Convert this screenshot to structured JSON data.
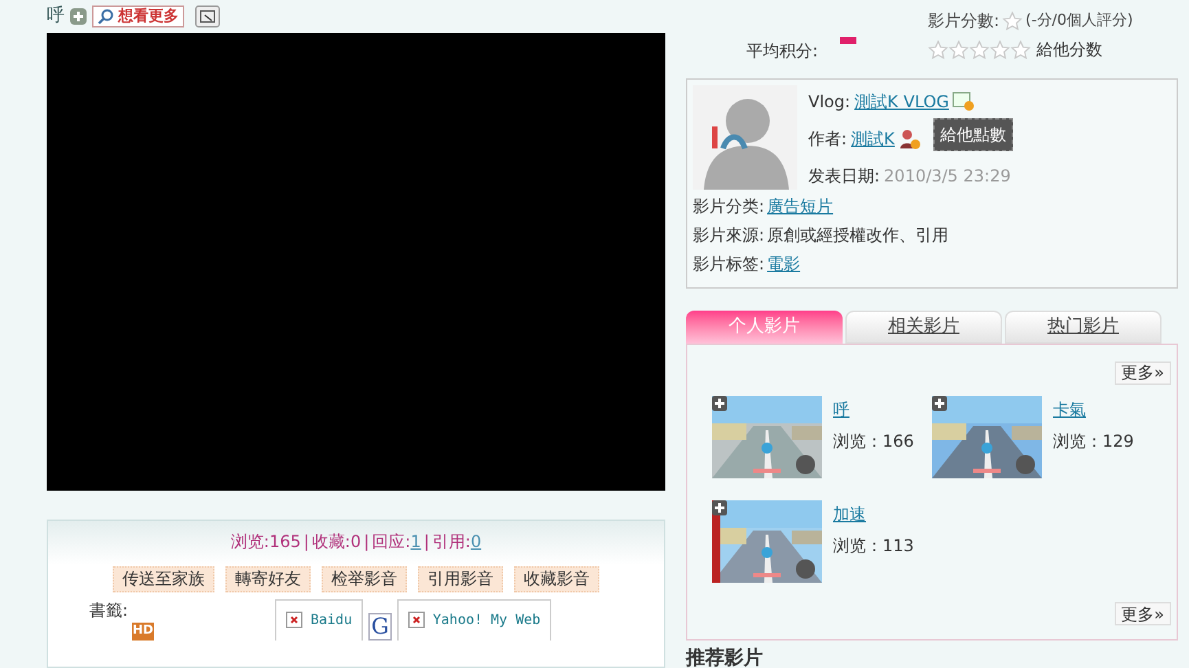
{
  "video": {
    "title": "呼",
    "more_button": "想看更多"
  },
  "rating": {
    "score_label": "影片分數:",
    "score_text": "(-分/0個人評分)",
    "average_label": "平均积分:",
    "stars": 0,
    "give_label": "給他分数"
  },
  "info": {
    "vlog_label": "Vlog:",
    "vlog_link": "測試K VLOG",
    "author_label": "作者:",
    "author_link": "測試K",
    "tooltip": "給他點數",
    "date_label": "发表日期:",
    "date": "2010/3/5 23:29",
    "fields": [
      {
        "label": "影片分类:",
        "value": "廣告短片",
        "kind": "link"
      },
      {
        "label": "影片來源:",
        "value": "原創或經授權改作、引用",
        "kind": "text"
      },
      {
        "label": "影片标签:",
        "value": "電影",
        "kind": "link"
      }
    ]
  },
  "tabs": [
    {
      "label": "个人影片",
      "selected": true
    },
    {
      "label": "相关影片",
      "selected": false
    },
    {
      "label": "热门影片",
      "selected": false
    }
  ],
  "more": "更多»",
  "more_bottom": "更多»",
  "videos": [
    {
      "title": "呼",
      "views_label": "浏览：",
      "views": "166"
    },
    {
      "title": "卡氣",
      "views_label": "浏览：",
      "views": "129"
    },
    {
      "title": "加速",
      "views_label": "浏览：",
      "views": "113"
    }
  ],
  "stats": [
    {
      "text": "浏览:165",
      "kind": "text"
    },
    {
      "text": "|",
      "kind": "sep"
    },
    {
      "text": "收藏:0",
      "kind": "text"
    },
    {
      "text": "|",
      "kind": "sep"
    },
    {
      "text": "回应:",
      "kind": "text"
    },
    {
      "text": "1",
      "kind": "link"
    },
    {
      "text": "|",
      "kind": "sep"
    },
    {
      "text": "引用:",
      "kind": "text"
    },
    {
      "text": "0",
      "kind": "link"
    }
  ],
  "actions": [
    "传送至家族",
    "轉寄好友",
    "检举影音",
    "引用影音",
    "收藏影音"
  ],
  "bookmarks": {
    "label": "書籤:",
    "hd": "HD",
    "items": [
      {
        "name": "Baidu",
        "kind": "link"
      },
      {
        "name": "G",
        "kind": "logo"
      },
      {
        "name": "Yahoo! My Web",
        "kind": "link"
      }
    ]
  },
  "recommended": {
    "title": "推荐影片"
  }
}
